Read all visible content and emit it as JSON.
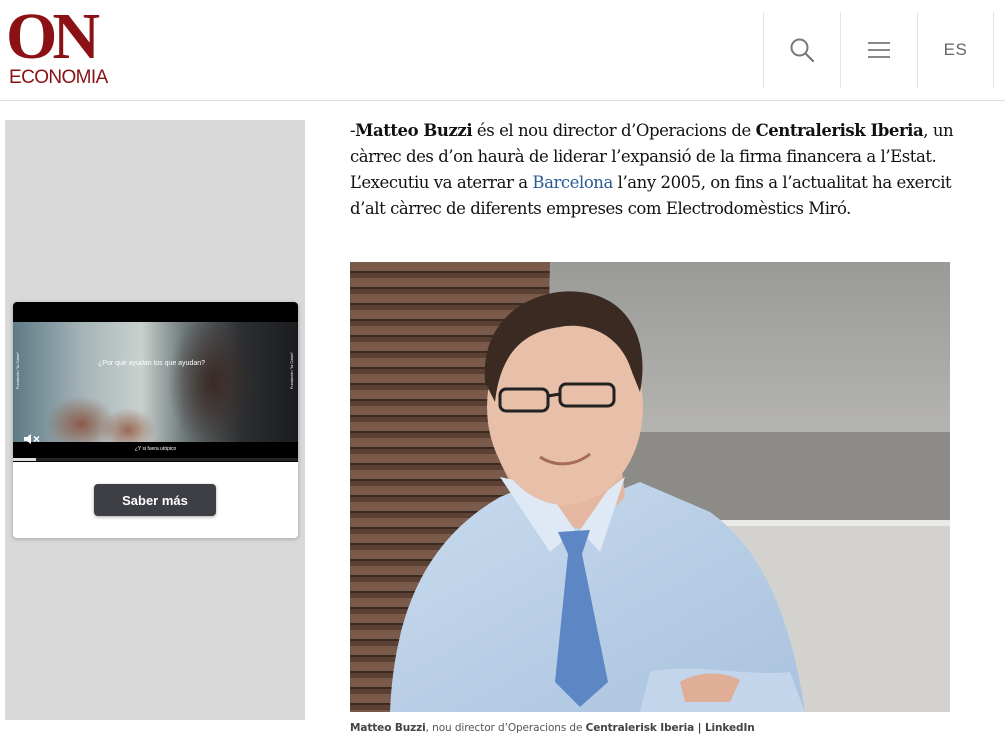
{
  "header": {
    "logo_main": "ON",
    "logo_sub": "ECONOMIA",
    "search_icon": "search-icon",
    "menu_icon": "hamburger-menu-icon",
    "language_label": "ES",
    "brand_color": "#8b1114"
  },
  "sidebar_ad": {
    "video_caption": "¿Por qué ayudan los que ayudan?",
    "video_subtitle": "¿Y si fuera utópico",
    "side_label": "Fundación \"la Caixa\"",
    "mute_icon": "mute-speaker-icon",
    "progress": 0.08,
    "cta_label": "Saber más"
  },
  "article": {
    "lead_prefix": "-",
    "person_name": "Matteo Buzzi",
    "text_1": " és el nou director d’Operacions de ",
    "company": "Centralerisk Iberia",
    "text_2": ", un càrrec des d’on haurà de liderar l’expansió de la firma financera a l’Estat. L’executiu va aterrar a ",
    "city_link": "Barcelona",
    "text_3": " l’any 2005, on fins a l’actualitat ha exercit d’alt càrrec de diferents empreses com Electrodomèstics Miró.",
    "link_color": "#285b96"
  },
  "photo": {
    "subject": "Portrait of Matteo Buzzi"
  },
  "caption": {
    "name": "Matteo Buzzi",
    "text": ", nou director d’Operacions de ",
    "company": "Centralerisk Iberia",
    "source": " | LinkedIn"
  }
}
